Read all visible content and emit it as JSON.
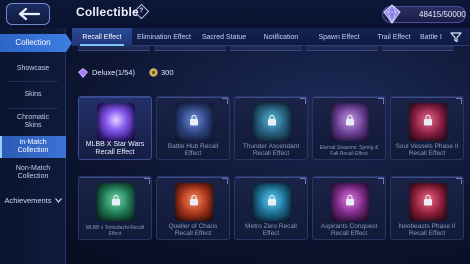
{
  "header": {
    "back_icon": "back-arrow-icon",
    "title": "Collectible",
    "help_icon": "help-diamond-icon",
    "help_glyph": "?",
    "currency": {
      "icon": "diamond-rank-icon",
      "value": "48415/50000"
    }
  },
  "tabs": [
    {
      "label": "Recall Effect",
      "active": true
    },
    {
      "label": "Elimination Effect",
      "active": false
    },
    {
      "label": "Sacred Statue",
      "active": false
    },
    {
      "label": "Notification",
      "active": false
    },
    {
      "label": "Spawn Effect",
      "active": false
    },
    {
      "label": "Trail Effect",
      "active": false
    },
    {
      "label": "Battle I",
      "active": false
    }
  ],
  "filter_icon": "filter-icon",
  "sidebar": {
    "section_label": "Collection",
    "items": [
      {
        "label": "Showcase",
        "selected": false
      },
      {
        "label": "Skins",
        "selected": false
      },
      {
        "label": "Chromatic Skins",
        "selected": false
      },
      {
        "label": "In-Match Collection",
        "selected": true
      },
      {
        "label": "Non-Match Collection",
        "selected": false
      }
    ],
    "achievements_label": "Achievements"
  },
  "group": {
    "label": "Deluxe(1/54)",
    "count": "300",
    "icon": "deluxe-diamond-icon",
    "count_icon": "points-icon"
  },
  "cards": [
    {
      "label": "MLBB X Star Wars Recall Effect",
      "owned": true,
      "art_color": "#6a3fd0"
    },
    {
      "label": "Battle Hub Recall Effect",
      "owned": false,
      "art_color": "#3a5db0"
    },
    {
      "label": "Thunder Ascendant Recall Effect",
      "owned": false,
      "art_color": "#2f7fa8"
    },
    {
      "label": "Eternal Seasons: Spring & Fall Recall Effect",
      "owned": false,
      "art_color": "#8a5ab4"
    },
    {
      "label": "Soul Vessels Phase II Recall Effect",
      "owned": false,
      "art_color": "#a8305a"
    },
    {
      "label": "MLBB x Tomodachi Recall Effect",
      "owned": false,
      "art_color": "#2e9a6a"
    },
    {
      "label": "Queller of Chaos Recall Effect",
      "owned": false,
      "art_color": "#c0402a"
    },
    {
      "label": "Metro Zero Recall Effect",
      "owned": false,
      "art_color": "#2a8cb0"
    },
    {
      "label": "Aspirants Conquest Recall Effect",
      "owned": false,
      "art_color": "#9a3f9a"
    },
    {
      "label": "Neobeasts Phase II Recall Effect",
      "owned": false,
      "art_color": "#b02a4a"
    }
  ]
}
